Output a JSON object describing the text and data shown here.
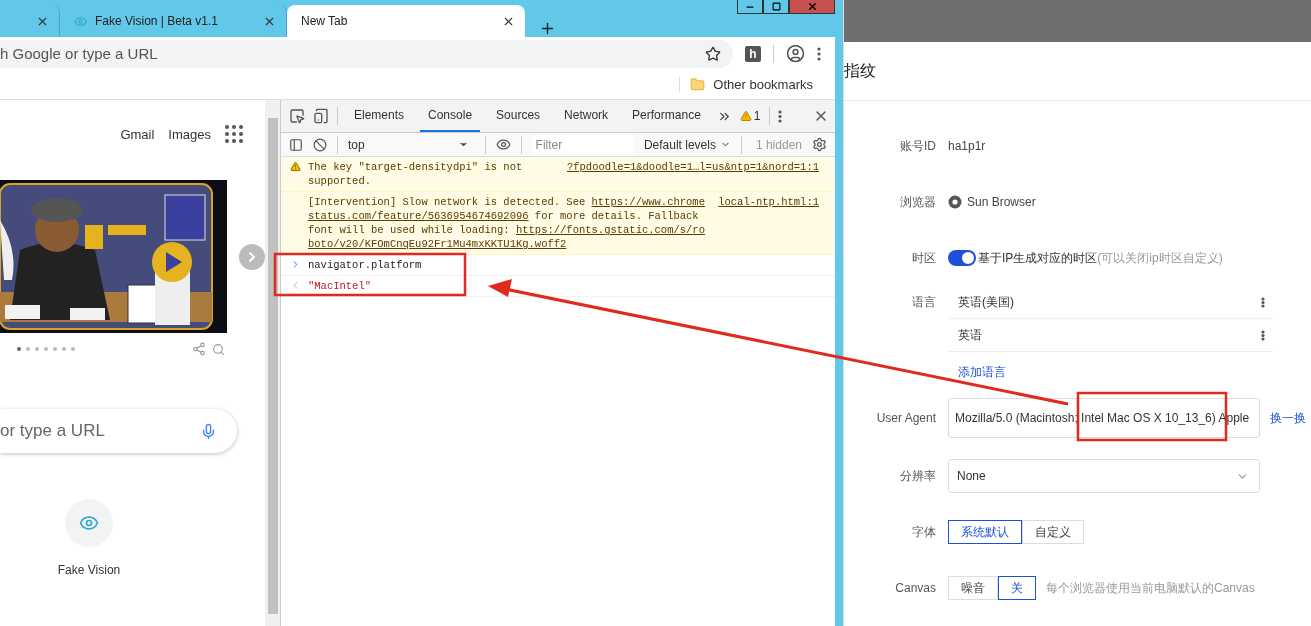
{
  "browser": {
    "tabs": [
      {
        "selected": false
      },
      {
        "title": "Fake Vision | Beta v1.1",
        "selected": false
      },
      {
        "title": "New Tab",
        "selected": true
      }
    ],
    "omnibox": {
      "placeholder": "h Google or type a URL"
    },
    "extension_badge": "h",
    "bookmarks": [
      {
        "label": "Other bookmarks"
      }
    ]
  },
  "new_tab_page": {
    "links": [
      "Gmail",
      "Images"
    ],
    "carousel": [
      {
        "selected": true
      },
      {
        "selected": false
      },
      {
        "selected": false
      },
      {
        "selected": false
      },
      {
        "selected": false
      },
      {
        "selected": false
      },
      {
        "selected": false
      }
    ],
    "search": {
      "placeholder": "or type a URL"
    },
    "shortcuts": [
      {
        "label": "Fake Vision"
      }
    ]
  },
  "devtools": {
    "tabs": [
      {
        "label": "Elements",
        "selected": false
      },
      {
        "label": "Console",
        "selected": true
      },
      {
        "label": "Sources",
        "selected": false
      },
      {
        "label": "Network",
        "selected": false
      },
      {
        "label": "Performance",
        "selected": false
      }
    ],
    "warning_count": "1",
    "context": "top",
    "filter": {
      "placeholder": "Filter"
    },
    "levels": "Default levels",
    "hidden": "1 hidden",
    "messages": [
      {
        "kind": "warning",
        "source": "?fpdoodle=1&doodle=1…l=us&ntp=1&nord=1:1",
        "segments": [
          {
            "kind": "text",
            "text": "The key \"target-densitydpi\" is not supported."
          }
        ]
      },
      {
        "kind": "log",
        "source": "local-ntp.html:1",
        "segments": [
          {
            "kind": "text",
            "text": "[Intervention] Slow network is detected. See "
          },
          {
            "kind": "link",
            "text": "https://www.chromestatus.com/feature/5636954674692096"
          },
          {
            "kind": "text",
            "text": " for more details. Fallback font will be used while loading: "
          },
          {
            "kind": "link",
            "text": "https://fonts.gstatic.com/s/roboto/v20/KFOmCnqEu92Fr1Mu4mxKKTU1Kg.woff2"
          }
        ]
      },
      {
        "kind": "input",
        "segments": [
          {
            "kind": "text",
            "text": "navigator.platform"
          }
        ]
      },
      {
        "kind": "result",
        "segments": [
          {
            "kind": "text",
            "text": "\"MacIntel\""
          }
        ]
      }
    ]
  },
  "profile_panel": {
    "title": "指纹",
    "fields": [
      {
        "kind": "text",
        "label": "账号ID",
        "value": "ha1p1r"
      },
      {
        "kind": "browser",
        "label": "浏览器",
        "value": "Sun Browser"
      },
      {
        "kind": "switch",
        "label": "时区",
        "on": true,
        "text": "基于IP生成对应的时区",
        "hint": "(可以关闭ip时区自定义)"
      },
      {
        "kind": "languages",
        "label": "语言",
        "items": [
          "英语(美国)",
          "英语"
        ],
        "add": "添加语言"
      },
      {
        "kind": "input",
        "label": "User Agent",
        "value": "Mozilla/5.0 (Macintosh; Intel Mac OS X 10_13_6) Apple",
        "action": "换一换"
      },
      {
        "kind": "select",
        "label": "分辨率",
        "value": "None"
      },
      {
        "kind": "segmented",
        "label": "字体",
        "options": [
          {
            "label": "系统默认",
            "selected": true
          },
          {
            "label": "自定义",
            "selected": false
          }
        ]
      },
      {
        "kind": "segmented",
        "label": "Canvas",
        "options": [
          {
            "label": "噪音",
            "selected": false
          },
          {
            "label": "关",
            "selected": true
          }
        ],
        "hint": "每个浏览器使用当前电脑默认的Canvas"
      }
    ]
  }
}
